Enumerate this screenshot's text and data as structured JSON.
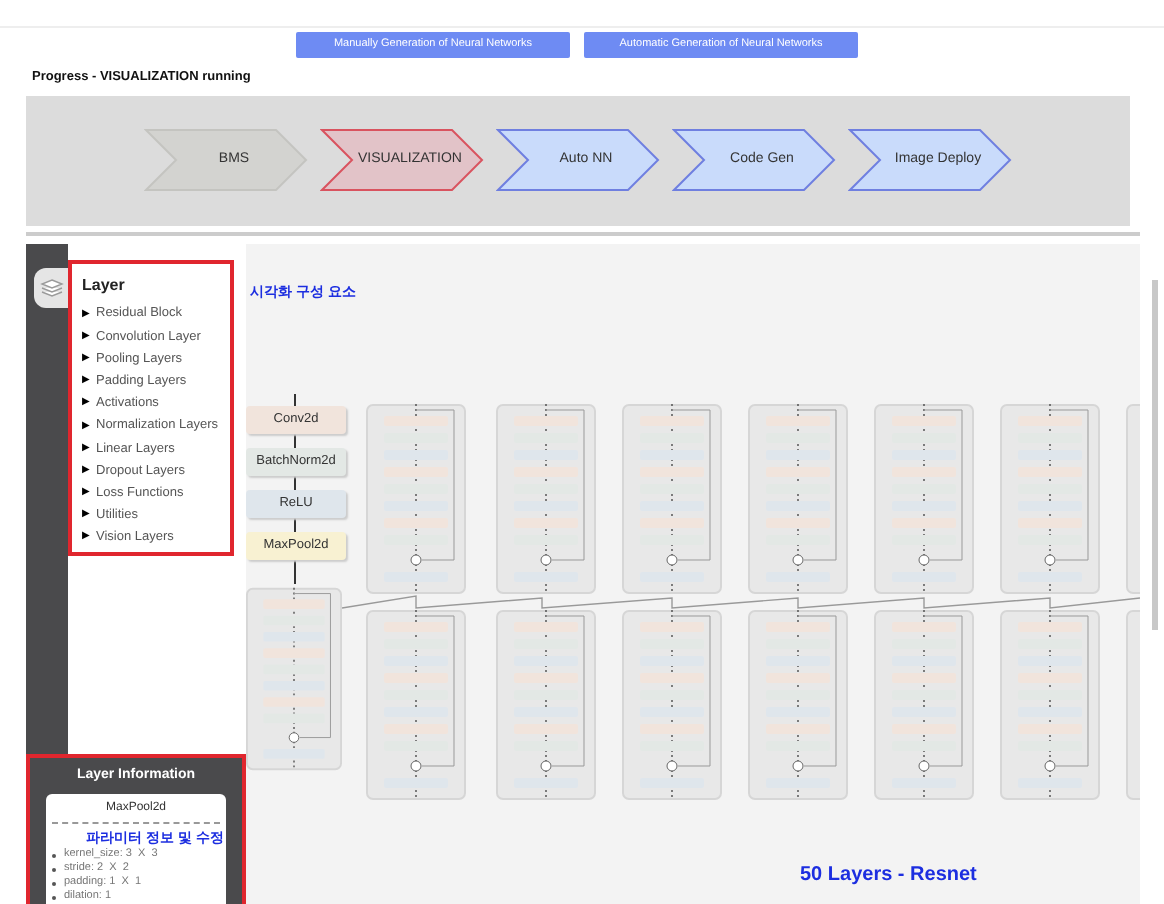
{
  "buttons": [
    {
      "label": "Manually Generation of Neural Networks"
    },
    {
      "label": "Automatic Generation of Neural Networks"
    }
  ],
  "progress": {
    "label": "Progress - VISUALIZATION running"
  },
  "steps": [
    {
      "label": "BMS",
      "kind": "done"
    },
    {
      "label": "VISUALIZATION",
      "kind": "current"
    },
    {
      "label": "Auto NN",
      "kind": "pending"
    },
    {
      "label": "Code Gen",
      "kind": "pending"
    },
    {
      "label": "Image Deploy",
      "kind": "pending"
    }
  ],
  "layer_panel": {
    "title": "Layer",
    "items": [
      {
        "label": "Residual Block"
      },
      {
        "label": "Convolution Layer"
      },
      {
        "label": "Pooling Layers"
      },
      {
        "label": "Padding Layers"
      },
      {
        "label": "Activations"
      },
      {
        "label": "Normalization Layers"
      },
      {
        "label": "Linear Layers"
      },
      {
        "label": "Dropout Layers"
      },
      {
        "label": "Loss Functions"
      },
      {
        "label": "Utilities"
      },
      {
        "label": "Vision Layers"
      }
    ],
    "expander": "▶"
  },
  "layer_info": {
    "title": "Layer Information",
    "layer": "MaxPool2d",
    "params": [
      "kernel_size: 3  X  3",
      "stride: 2  X  2",
      "padding: 1  X  1",
      "dilation: 1"
    ]
  },
  "annotations": {
    "components": "시각화 구성 요소",
    "params": "파라미터 정보 및 수정",
    "model": "50 Layers - Resnet"
  },
  "diagram": {
    "stem": [
      {
        "label": "Conv2d",
        "color": "#f1e4dc"
      },
      {
        "label": "BatchNorm2d",
        "color": "#e3e8e5"
      },
      {
        "label": "ReLU",
        "color": "#dfe6ec"
      },
      {
        "label": "MaxPool2d",
        "color": "#f8f1d2"
      }
    ],
    "blocks": [
      {
        "kind": "first"
      },
      {
        "kind": "top"
      },
      {
        "kind": "top"
      },
      {
        "kind": "top"
      },
      {
        "kind": "top"
      },
      {
        "kind": "top"
      },
      {
        "kind": "top"
      },
      {
        "kind": "top"
      },
      {
        "kind": "bottom"
      },
      {
        "kind": "bottom"
      },
      {
        "kind": "bottom"
      },
      {
        "kind": "bottom"
      },
      {
        "kind": "bottom"
      },
      {
        "kind": "bottom"
      },
      {
        "kind": "bottom"
      }
    ]
  }
}
